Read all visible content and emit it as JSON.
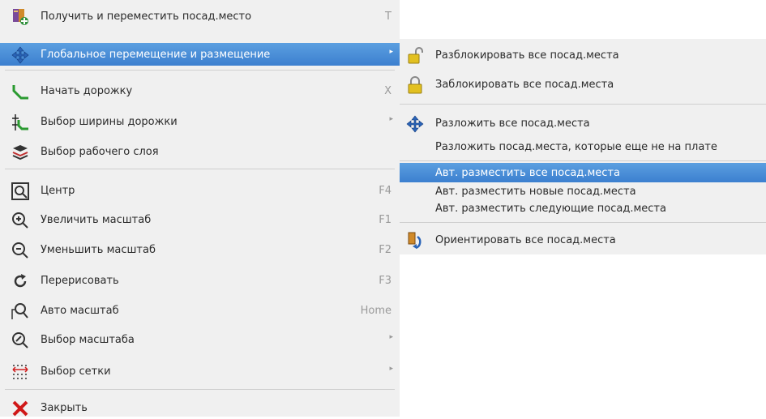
{
  "main_menu": {
    "items": [
      {
        "label": "Получить и переместить посад.место",
        "shortcut": "T",
        "icon": "footprint-move-icon"
      },
      {
        "label": "Глобальное перемещение и размещение",
        "icon": "move-arrows-icon"
      },
      {
        "label": "Начать дорожку",
        "shortcut": "X",
        "icon": "track-icon"
      },
      {
        "label": "Выбор ширины дорожки",
        "icon": "track-width-icon"
      },
      {
        "label": "Выбор рабочего слоя",
        "icon": "layers-icon"
      },
      {
        "label": "Центр",
        "shortcut": "F4",
        "icon": "zoom-center-icon"
      },
      {
        "label": "Увеличить масштаб",
        "shortcut": "F1",
        "icon": "zoom-in-icon"
      },
      {
        "label": "Уменьшить масштаб",
        "shortcut": "F2",
        "icon": "zoom-out-icon"
      },
      {
        "label": "Перерисовать",
        "shortcut": "F3",
        "icon": "redraw-icon"
      },
      {
        "label": "Авто масштаб",
        "shortcut": "Home",
        "icon": "zoom-auto-icon"
      },
      {
        "label": "Выбор масштаба",
        "icon": "zoom-select-icon"
      },
      {
        "label": "Выбор сетки",
        "icon": "grid-icon"
      },
      {
        "label": "Закрыть",
        "icon": "close-icon"
      }
    ]
  },
  "sub_menu": {
    "items": [
      {
        "label": "Разблокировать все посад.места",
        "icon": "unlock-icon"
      },
      {
        "label": "Заблокировать все посад.места",
        "icon": "lock-icon"
      },
      {
        "label": "Разложить все посад.места",
        "icon": "move-arrows-icon"
      },
      {
        "label": "Разложить посад.места, которые еще не на плате"
      },
      {
        "label": "Авт. разместить все посад.места"
      },
      {
        "label": "Авт. разместить новые посад.места"
      },
      {
        "label": "Авт. разместить следующие посад.места"
      },
      {
        "label": "Ориентировать все посад.места",
        "icon": "orient-icon"
      }
    ]
  },
  "colors": {
    "highlight": "#4a8fd8",
    "menu_bg": "#f0f0f0",
    "separator": "#cfcfcf"
  }
}
